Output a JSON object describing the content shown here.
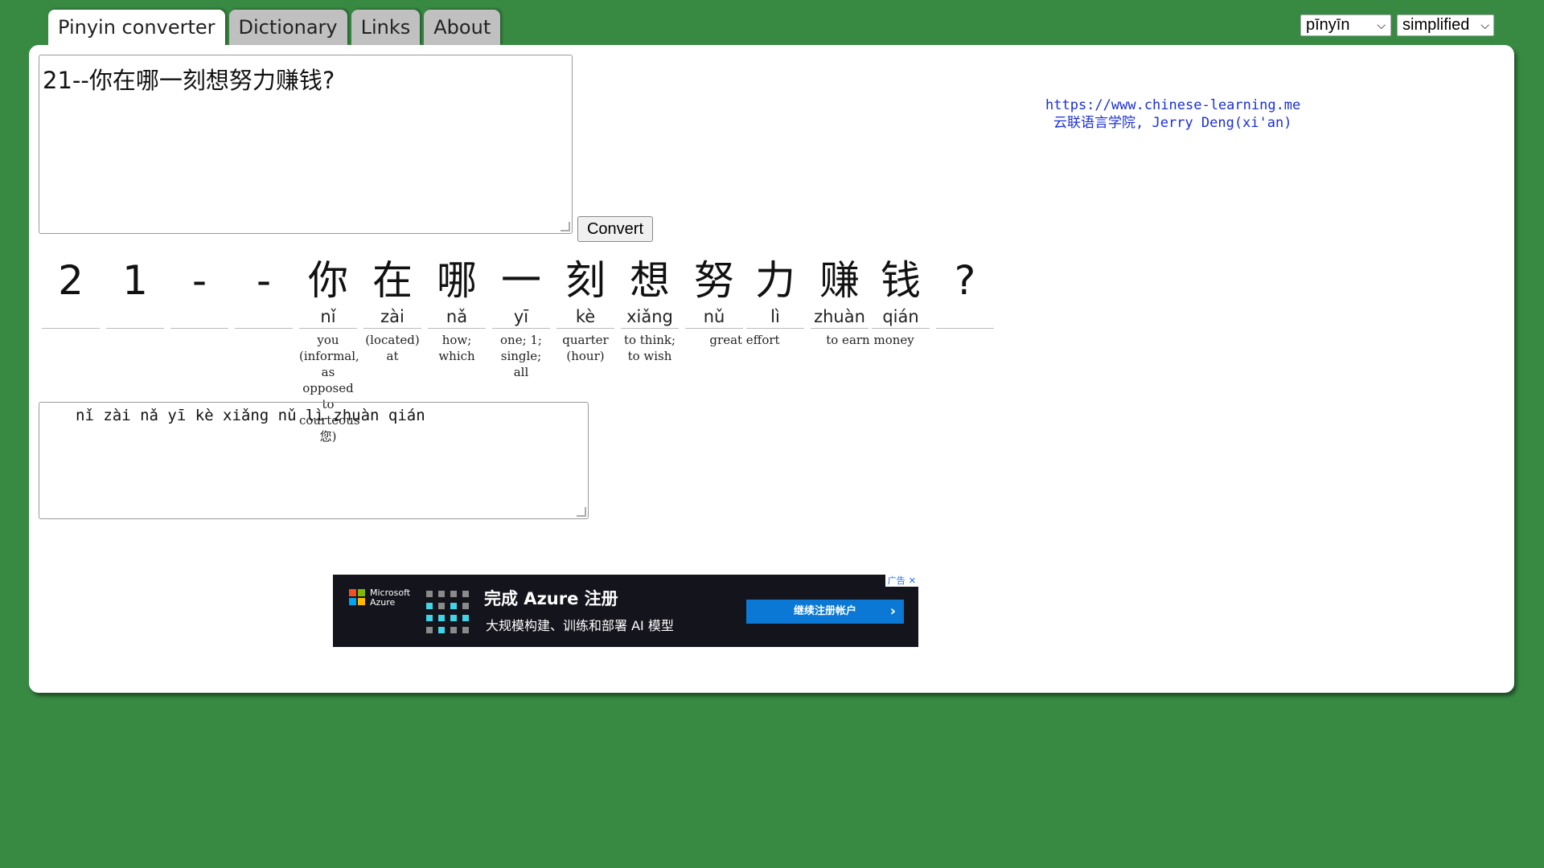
{
  "tabs": [
    {
      "label": "Pinyin converter",
      "active": true
    },
    {
      "label": "Dictionary",
      "active": false
    },
    {
      "label": "Links",
      "active": false
    },
    {
      "label": "About",
      "active": false
    }
  ],
  "selects": {
    "tone_mode": "pīnyīn",
    "script": "simplified"
  },
  "input": {
    "value": "21--你在哪一刻想努力赚钱?"
  },
  "convert_label": "Convert",
  "credit": {
    "url": "https://www.chinese-learning.me",
    "author": "云联语言学院, Jerry Deng(xi'an)"
  },
  "characters": [
    {
      "hanzi": "2",
      "pinyin": "",
      "gloss": ""
    },
    {
      "hanzi": "1",
      "pinyin": "",
      "gloss": ""
    },
    {
      "hanzi": "-",
      "pinyin": "",
      "gloss": ""
    },
    {
      "hanzi": "-",
      "pinyin": "",
      "gloss": ""
    },
    {
      "hanzi": "你",
      "pinyin": "nǐ",
      "gloss": "you (informal, as opposed to courteous 您)"
    },
    {
      "hanzi": "在",
      "pinyin": "zài",
      "gloss": "(located) at"
    },
    {
      "hanzi": "哪",
      "pinyin": "nǎ",
      "gloss": "how; which"
    },
    {
      "hanzi": "一",
      "pinyin": "yī",
      "gloss": "one; 1; single; all"
    },
    {
      "hanzi": "刻",
      "pinyin": "kè",
      "gloss": "quarter (hour)"
    },
    {
      "hanzi": "想",
      "pinyin": "xiǎng",
      "gloss": "to think; to wish"
    },
    {
      "hanzi": "努",
      "pinyin": "nǔ",
      "gloss": "great effort"
    },
    {
      "hanzi": "力",
      "pinyin": "lì",
      "gloss": ""
    },
    {
      "hanzi": "赚",
      "pinyin": "zhuàn",
      "gloss": "to earn money"
    },
    {
      "hanzi": "钱",
      "pinyin": "qián",
      "gloss": ""
    },
    {
      "hanzi": "?",
      "pinyin": "",
      "gloss": ""
    }
  ],
  "output": {
    "value": "nǐ zài nǎ yī kè xiǎng nǔ lì zhuàn qián"
  },
  "ad": {
    "brand": "Microsoft Azure",
    "title": "完成 Azure 注册",
    "subtitle": "大规模构建、训练和部署 AI 模型",
    "button": "继续注册帐户",
    "badge": "广告"
  }
}
